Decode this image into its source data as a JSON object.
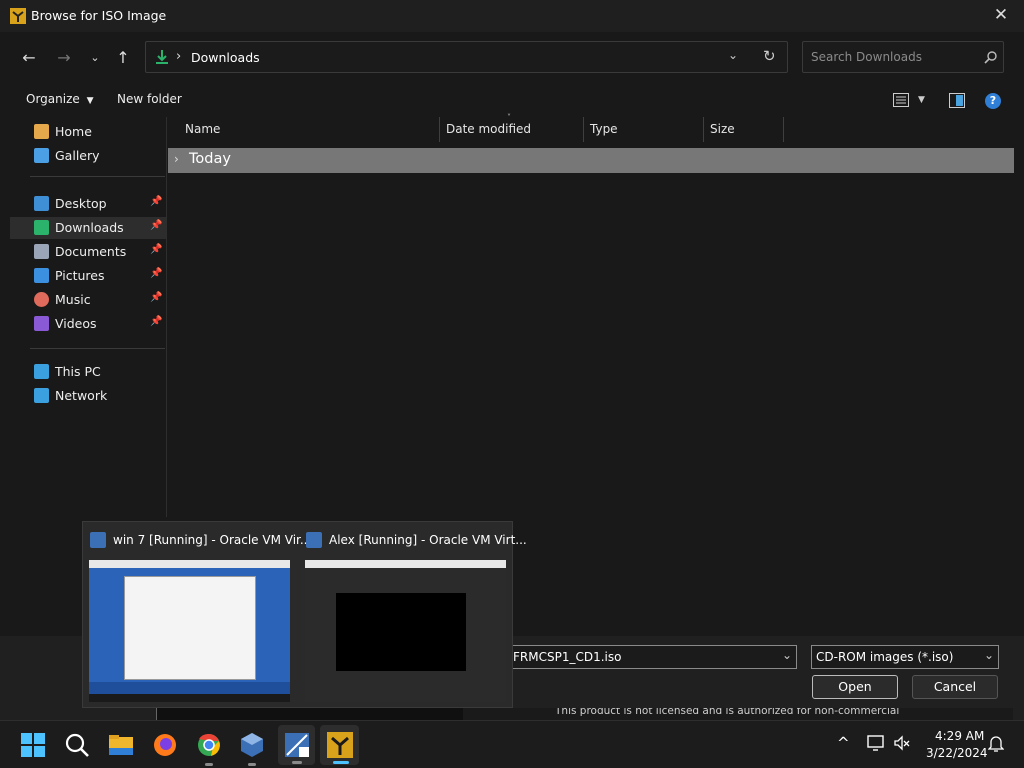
{
  "dialog": {
    "title": "Browse for ISO Image",
    "address": {
      "location": "Downloads",
      "separator": "›"
    },
    "search": {
      "placeholder": "Search Downloads"
    },
    "toolbar": {
      "organize_label": "Organize",
      "new_folder_label": "New folder"
    },
    "nav": {
      "quick": [
        {
          "label": "Home",
          "icon": "home-icon",
          "color": "#e5a84a"
        },
        {
          "label": "Gallery",
          "icon": "gallery-icon",
          "color": "#4a9fe5"
        }
      ],
      "pinned": [
        {
          "label": "Desktop",
          "icon": "desktop-icon",
          "color": "#3f8fd6",
          "pin": "📌"
        },
        {
          "label": "Downloads",
          "icon": "download-icon",
          "color": "#2cb36b",
          "pin": "📌",
          "selected": true
        },
        {
          "label": "Documents",
          "icon": "documents-icon",
          "color": "#9aa6b8",
          "pin": "📌"
        },
        {
          "label": "Pictures",
          "icon": "pictures-icon",
          "color": "#3b90e0",
          "pin": "📌"
        },
        {
          "label": "Music",
          "icon": "music-icon",
          "color": "#e06a5b",
          "pin": "📌"
        },
        {
          "label": "Videos",
          "icon": "videos-icon",
          "color": "#8a5ad6",
          "pin": "📌"
        }
      ],
      "system": [
        {
          "label": "This PC",
          "icon": "pc-icon",
          "color": "#3aa0e0"
        },
        {
          "label": "Network",
          "icon": "network-icon",
          "color": "#3aa0e0"
        }
      ]
    },
    "columns": [
      "Name",
      "Date modified",
      "Type",
      "Size"
    ],
    "group": {
      "label": "Today"
    },
    "file_name_value": "FRMCSP1_CD1.iso",
    "file_type_value": "CD-ROM images (*.iso)",
    "open_label": "Open",
    "cancel_label": "Cancel",
    "background_text": "This product is not licensed and is authorized for non-commercial"
  },
  "thumbnails": [
    {
      "title": "win 7 [Running] - Oracle VM Vir..."
    },
    {
      "title": "Alex [Running] - Oracle VM Virt..."
    }
  ],
  "taskbar": {
    "apps": [
      "start-icon",
      "search-icon",
      "file-explorer-icon",
      "firefox-icon",
      "chrome-icon",
      "virtualbox-icon",
      "win7-vm-icon",
      "vm-app-icon"
    ],
    "time": "4:29 AM",
    "date": "3/22/2024"
  },
  "colors": {
    "accent": "#4aa3df",
    "selection": "#2d2d2d",
    "group_row": "#777777"
  }
}
